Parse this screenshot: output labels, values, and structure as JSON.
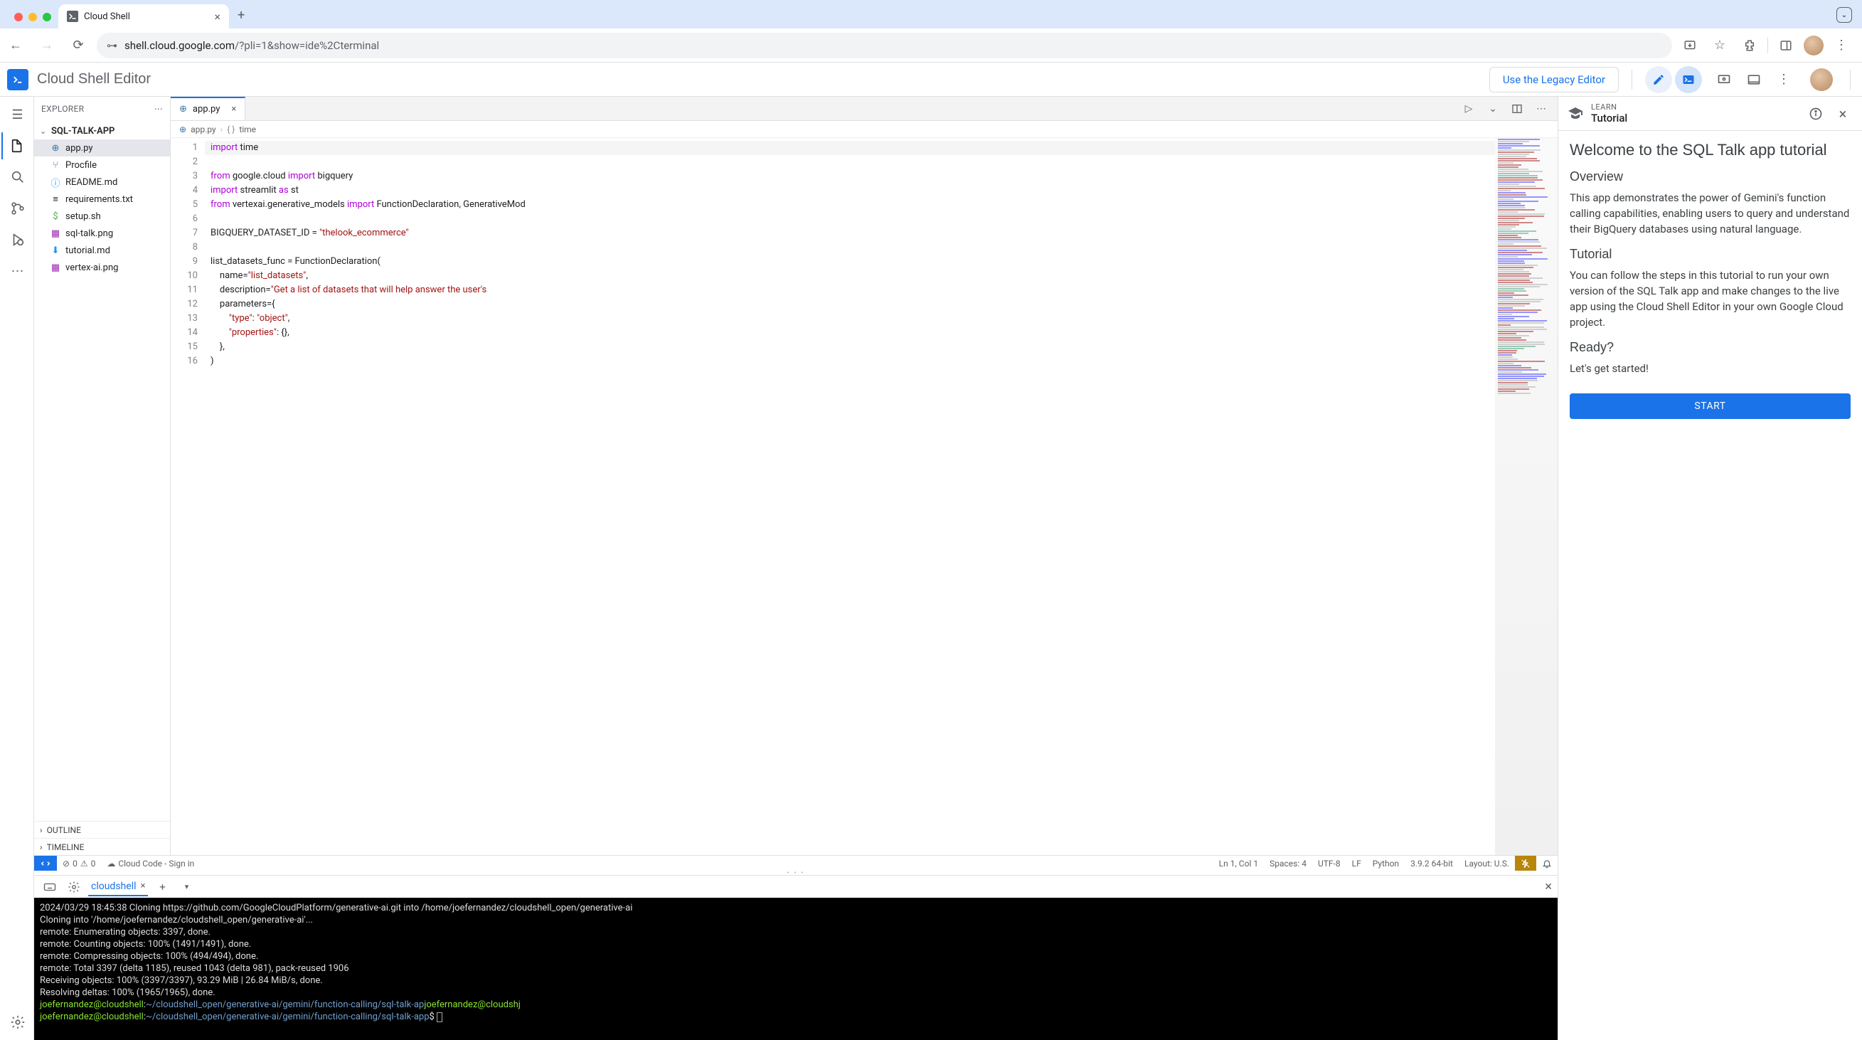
{
  "browser": {
    "tab_title": "Cloud Shell",
    "url_domain": "shell.cloud.google.com",
    "url_path": "/?pli=1&show=ide%2Cterminal"
  },
  "app_header": {
    "title": "Cloud Shell Editor",
    "legacy_button": "Use the Legacy Editor"
  },
  "explorer": {
    "title": "EXPLORER",
    "project": "SQL-TALK-APP",
    "files": [
      {
        "icon": "py",
        "name": "app.py",
        "selected": true
      },
      {
        "icon": "heroku",
        "name": "Procfile"
      },
      {
        "icon": "info",
        "name": "README.md"
      },
      {
        "icon": "txt",
        "name": "requirements.txt"
      },
      {
        "icon": "dollar",
        "name": "setup.sh"
      },
      {
        "icon": "img",
        "name": "sql-talk.png"
      },
      {
        "icon": "down",
        "name": "tutorial.md"
      },
      {
        "icon": "img",
        "name": "vertex-ai.png"
      }
    ],
    "outline": "OUTLINE",
    "timeline": "TIMELINE"
  },
  "editor": {
    "tab": "app.py",
    "breadcrumb_file": "app.py",
    "breadcrumb_symbol": "time",
    "lines": [
      {
        "html": "<span class='kw2'>import</span> time"
      },
      {
        "html": ""
      },
      {
        "html": "<span class='kw2'>from</span> google.cloud <span class='kw2'>import</span> bigquery"
      },
      {
        "html": "<span class='kw2'>import</span> streamlit <span class='kw2'>as</span> st"
      },
      {
        "html": "<span class='kw2'>from</span> vertexai.generative_models <span class='kw2'>import</span> FunctionDeclaration, GenerativeMod"
      },
      {
        "html": ""
      },
      {
        "html": "BIGQUERY_DATASET_ID = <span class='str'>\"thelook_ecommerce\"</span>"
      },
      {
        "html": ""
      },
      {
        "html": "list_datasets_func = FunctionDeclaration("
      },
      {
        "html": "    name=<span class='str'>\"list_datasets\"</span>,"
      },
      {
        "html": "    description=<span class='str'>\"Get a list of datasets that will help answer the user's </span>"
      },
      {
        "html": "    parameters={"
      },
      {
        "html": "        <span class='str'>\"type\"</span>: <span class='str'>\"object\"</span>,"
      },
      {
        "html": "        <span class='str'>\"properties\"</span>: {},"
      },
      {
        "html": "    },"
      },
      {
        "html": ")"
      }
    ]
  },
  "status": {
    "errors": "0",
    "warnings": "0",
    "cloud_code": "Cloud Code - Sign in",
    "position": "Ln 1, Col 1",
    "spaces": "Spaces: 4",
    "encoding": "UTF-8",
    "eol": "LF",
    "language": "Python",
    "interpreter": "3.9.2 64-bit",
    "layout": "Layout: U.S."
  },
  "terminal": {
    "tab": "cloudshell",
    "lines": [
      "2024/03/29 18:45:38 Cloning https://github.com/GoogleCloudPlatform/generative-ai.git into /home/joefernandez/cloudshell_open/generative-ai",
      "Cloning into '/home/joefernandez/cloudshell_open/generative-ai'...",
      "remote: Enumerating objects: 3397, done.",
      "remote: Counting objects: 100% (1491/1491), done.",
      "remote: Compressing objects: 100% (494/494), done.",
      "remote: Total 3397 (delta 1185), reused 1043 (delta 981), pack-reused 1906",
      "Receiving objects: 100% (3397/3397), 93.29 MiB | 26.84 MiB/s, done.",
      "Resolving deltas: 100% (1965/1965), done."
    ],
    "prompt_user": "joefernandez@cloudshell",
    "prompt_path1": "~/cloudshell_open/generative-ai/gemini/function-calling/sql-talk-ap",
    "prompt_user2": "joefernandez@cloudshj",
    "prompt_path2": "~/cloudshell_open/generative-ai/gemini/function-calling/sql-talk-app",
    "prompt_dollar": "$"
  },
  "tutorial": {
    "eyebrow": "LEARN",
    "panel_title": "Tutorial",
    "h1": "Welcome to the SQL Talk app tutorial",
    "overview_h": "Overview",
    "overview_p": "This app demonstrates the power of Gemini's function calling capabilities, enabling users to query and understand their BigQuery databases using natural language.",
    "tutorial_h": "Tutorial",
    "tutorial_p": "You can follow the steps in this tutorial to run your own version of the SQL Talk app and make changes to the live app using the Cloud Shell Editor in your own Google Cloud project.",
    "ready_h": "Ready?",
    "ready_p": "Let's get started!",
    "start": "START"
  }
}
